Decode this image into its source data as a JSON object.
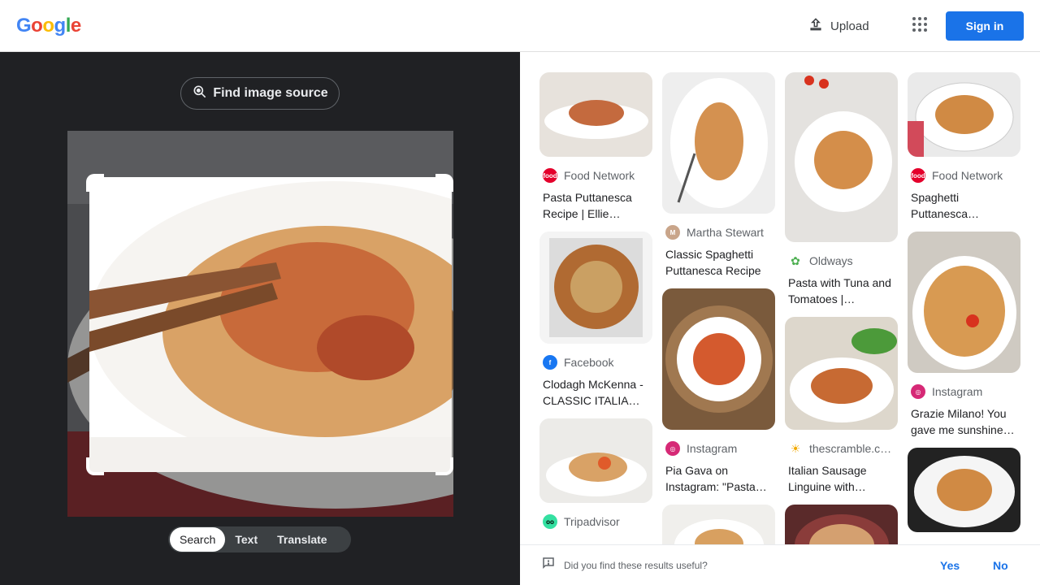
{
  "header": {
    "logo_letters": [
      "G",
      "o",
      "o",
      "g",
      "l",
      "e"
    ],
    "upload_label": "Upload",
    "signin_label": "Sign in"
  },
  "left_pane": {
    "find_source_label": "Find image source",
    "tabs": [
      {
        "label": "Search",
        "active": true
      },
      {
        "label": "Text",
        "active": false
      },
      {
        "label": "Translate",
        "active": false
      }
    ]
  },
  "results": {
    "columns": [
      [
        {
          "source": "Food Network",
          "title": "Pasta Puttanesca Recipe | Ellie…",
          "fav": "food-network",
          "thumb_h": 104
        },
        {
          "source": "Facebook",
          "title": "Clodagh McKenna - CLASSIC ITALIA…",
          "fav": "facebook",
          "thumb_h": 138
        },
        {
          "source": "Tripadvisor",
          "title": "",
          "fav": "tripadvisor",
          "thumb_h": 104
        }
      ],
      [
        {
          "source": "Martha Stewart",
          "title": "Classic Spaghetti Puttanesca Recipe",
          "fav": "martha-stewart",
          "thumb_h": 174
        },
        {
          "source": "Instagram",
          "title": "Pia Gava on Instagram: \"Pasta…",
          "fav": "instagram",
          "thumb_h": 174
        },
        {
          "source": "",
          "title": "",
          "fav": "",
          "thumb_h": 60
        }
      ],
      [
        {
          "source": "Oldways",
          "title": "Pasta with Tuna and Tomatoes |…",
          "fav": "oldways",
          "thumb_h": 209
        },
        {
          "source": "thescramble.c…",
          "title": "Italian Sausage Linguine with…",
          "fav": "thescramble",
          "thumb_h": 139
        },
        {
          "source": "",
          "title": "",
          "fav": "",
          "thumb_h": 60
        }
      ],
      [
        {
          "source": "Food Network",
          "title": "Spaghetti Puttanesca…",
          "fav": "food-network",
          "thumb_h": 104
        },
        {
          "source": "Instagram",
          "title": "Grazie Milano! You gave me sunshine…",
          "fav": "instagram",
          "thumb_h": 174
        },
        {
          "source": "",
          "title": "",
          "fav": "",
          "thumb_h": 104
        }
      ]
    ]
  },
  "feedback": {
    "question": "Did you find these results useful?",
    "yes_label": "Yes",
    "no_label": "No"
  },
  "colors": {
    "google_blue": "#4285f4",
    "google_red": "#ea4335",
    "google_yellow": "#fbbc05",
    "google_green": "#34a853",
    "accent": "#1a73e8",
    "dark_pane": "#202124"
  }
}
